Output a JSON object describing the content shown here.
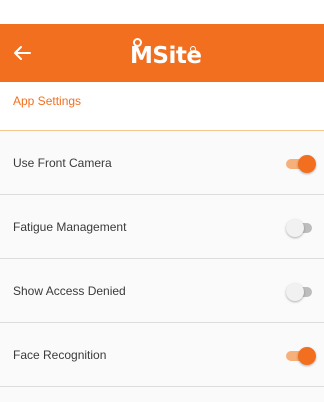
{
  "app": {
    "logo_text": "MSite",
    "brand_color": "#f26f1f"
  },
  "header": {
    "back_icon": "arrow-left-icon"
  },
  "section": {
    "title": "App Settings"
  },
  "settings": [
    {
      "label": "Use Front Camera",
      "enabled": true
    },
    {
      "label": "Fatigue Management",
      "enabled": false
    },
    {
      "label": "Show Access Denied",
      "enabled": false
    },
    {
      "label": "Face Recognition",
      "enabled": true
    }
  ]
}
